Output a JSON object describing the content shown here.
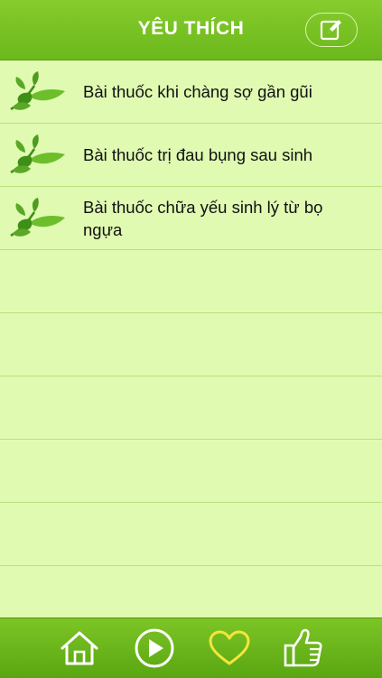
{
  "header": {
    "title": "YÊU THÍCH",
    "edit_icon": "edit-icon"
  },
  "list": {
    "items": [
      {
        "label": "Bài thuốc khi chàng sợ gần gũi"
      },
      {
        "label": "Bài thuốc trị đau bụng sau sinh"
      },
      {
        "label": "Bài thuốc chữa yếu sinh lý từ bọ ngựa"
      }
    ],
    "empty_rows": 6
  },
  "tabbar": {
    "tabs": [
      {
        "icon": "home-icon",
        "active": false
      },
      {
        "icon": "play-icon",
        "active": false
      },
      {
        "icon": "heart-icon",
        "active": true
      },
      {
        "icon": "thumbs-up-icon",
        "active": false
      }
    ]
  },
  "colors": {
    "header": "#7bc325",
    "background": "#e0fab2",
    "divider": "#b9e07c",
    "active_tab": "#f5e53a",
    "inactive_tab": "#ffffff"
  }
}
